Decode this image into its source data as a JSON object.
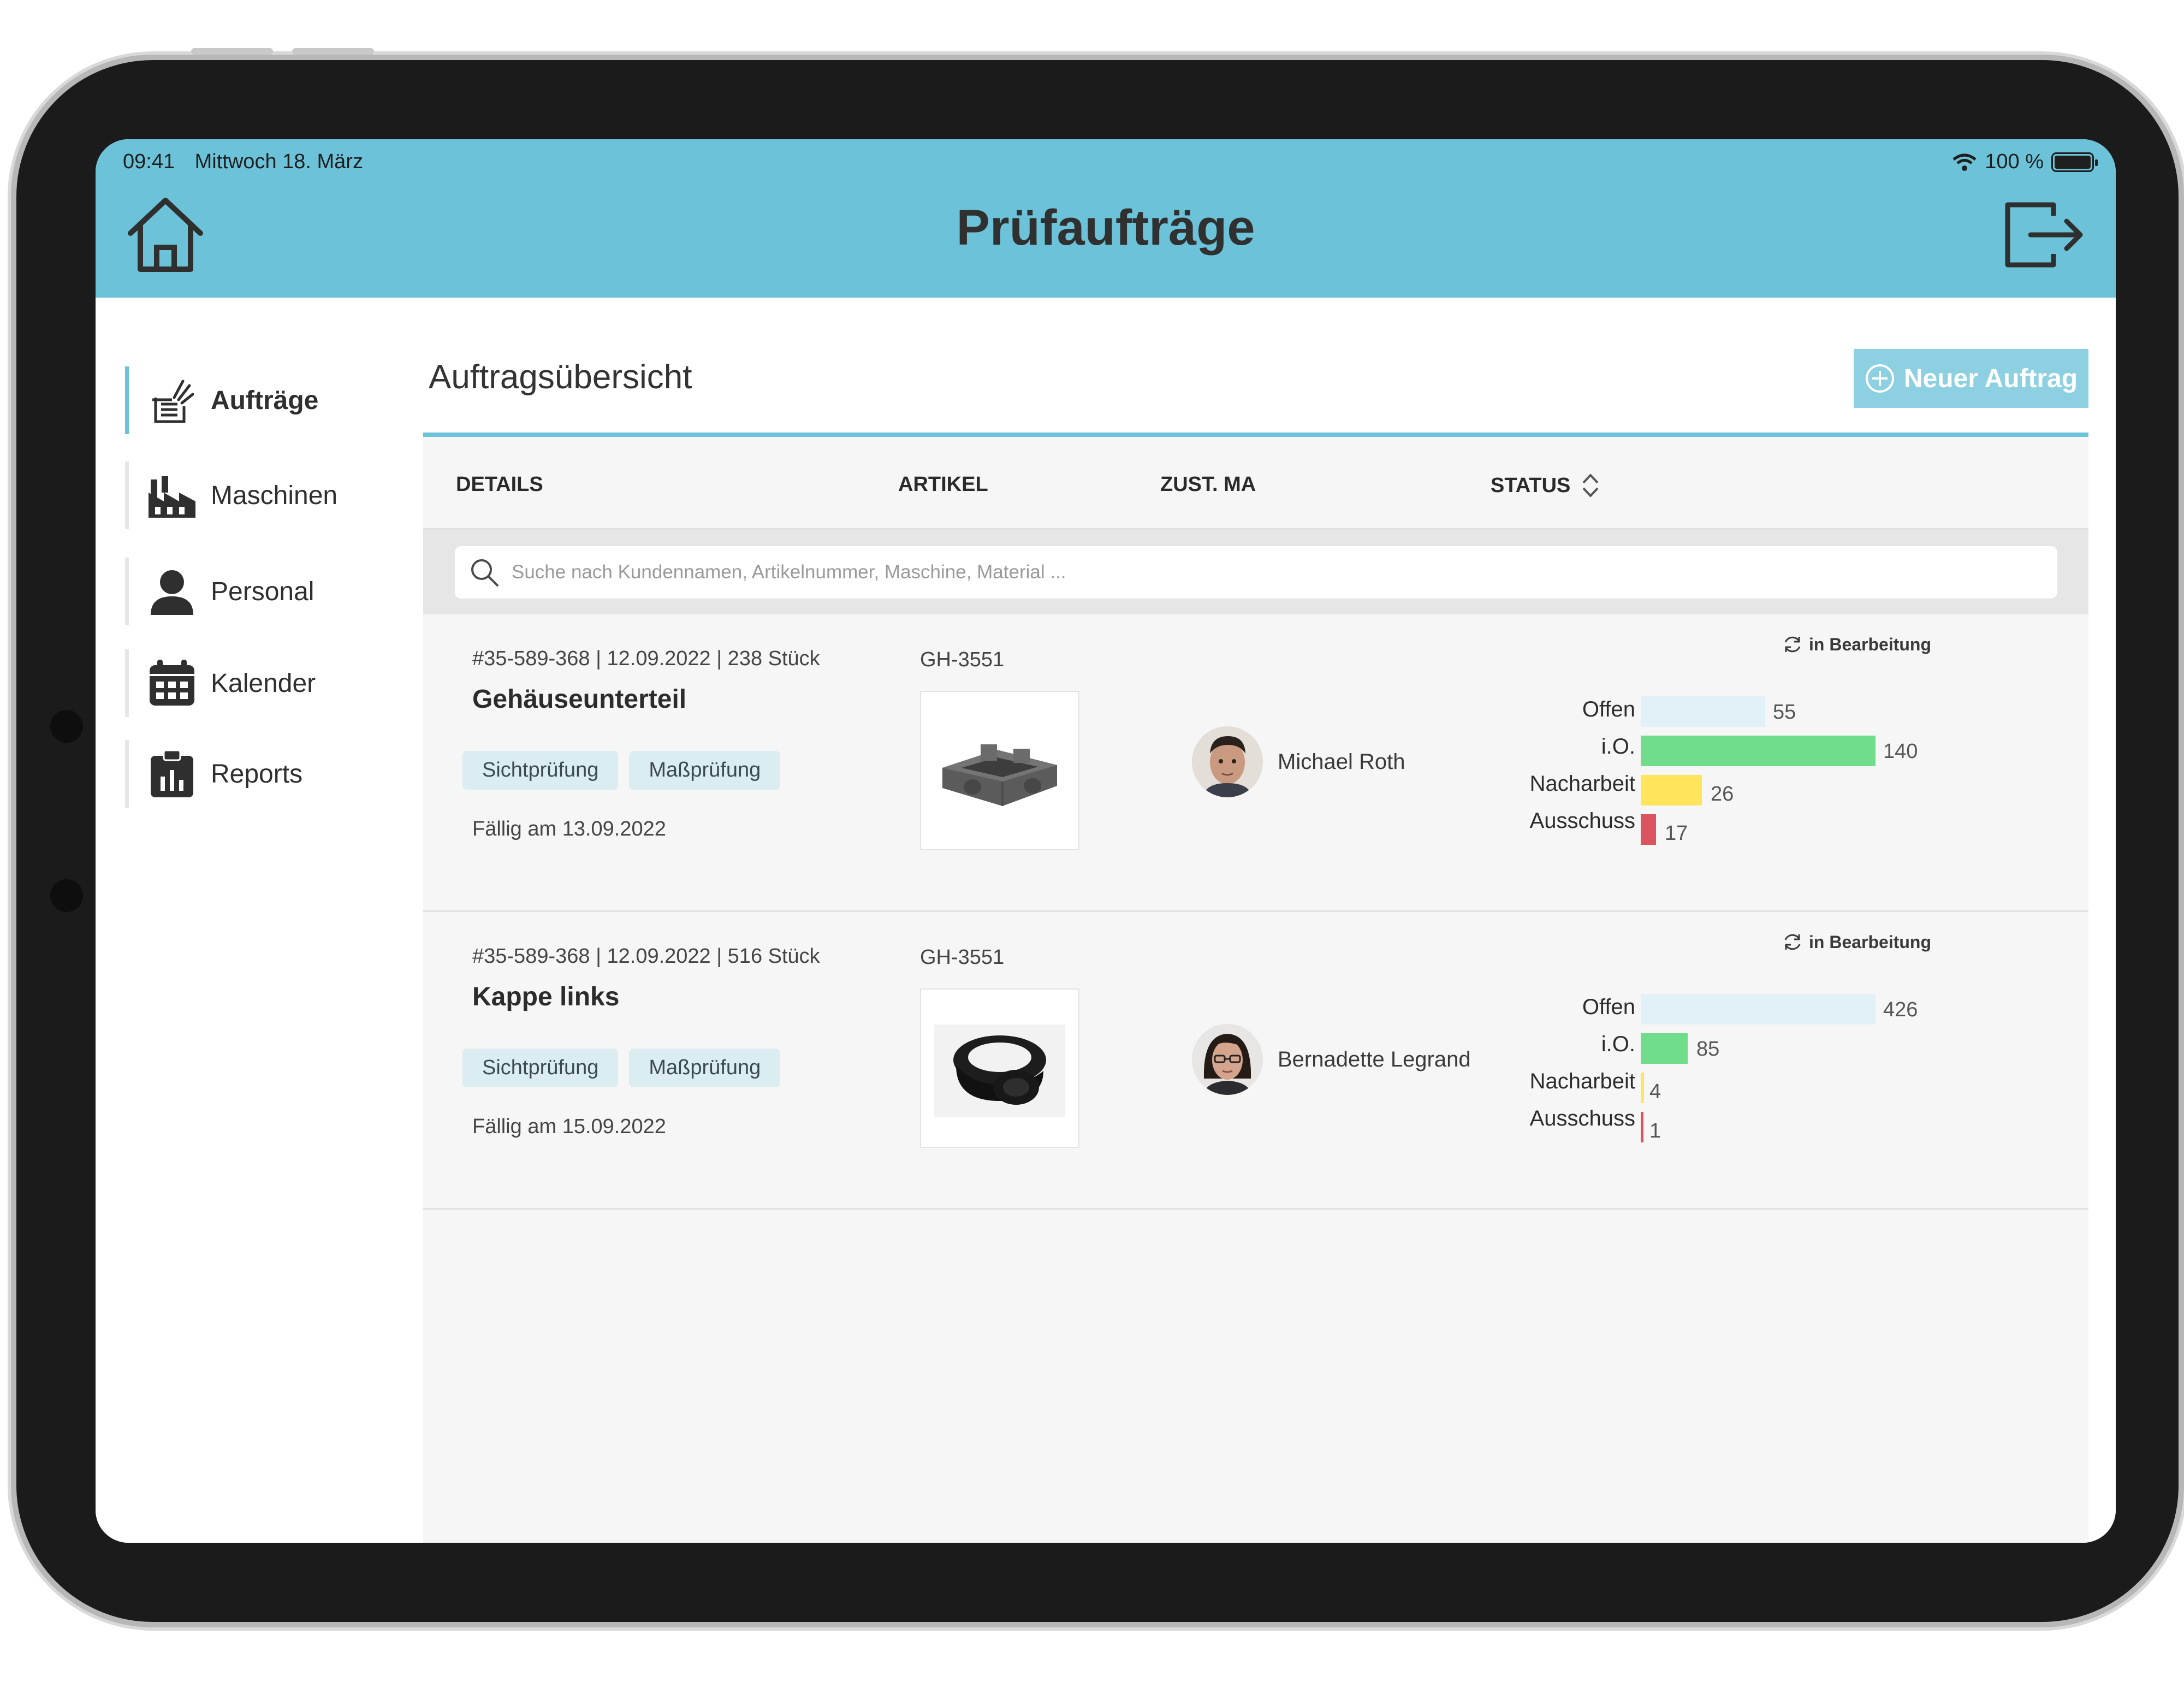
{
  "status_bar": {
    "time": "09:41",
    "date": "Mittwoch 18. März",
    "battery": "100 %"
  },
  "header": {
    "title": "Prüfaufträge"
  },
  "icons": {
    "home": "home-icon",
    "logout": "logout-icon",
    "search": "search-icon",
    "refresh": "refresh-icon",
    "plus": "plus-circle-icon",
    "sort": "sort-icon"
  },
  "sidebar": {
    "items": [
      {
        "label": "Aufträge",
        "icon": "orders-icon",
        "active": true
      },
      {
        "label": "Maschinen",
        "icon": "factory-icon",
        "active": false
      },
      {
        "label": "Personal",
        "icon": "person-icon",
        "active": false
      },
      {
        "label": "Kalender",
        "icon": "calendar-icon",
        "active": false
      },
      {
        "label": "Reports",
        "icon": "clipboard-chart-icon",
        "active": false
      }
    ]
  },
  "main": {
    "heading": "Auftragsübersicht",
    "new_order_label": "Neuer Auftrag",
    "columns": {
      "details": "DETAILS",
      "article": "ARTIKEL",
      "assignee": "ZUST. MA",
      "status": "STATUS"
    },
    "search": {
      "placeholder": "Suche nach Kundennamen, Artikelnummer, Maschine, Material ..."
    },
    "orders": [
      {
        "meta": "#35-589-368 | 12.09.2022 | 238 Stück",
        "title": "Gehäuseunterteil",
        "tags": [
          "Sichtprüfung",
          "Maßprüfung"
        ],
        "due": "Fällig am 13.09.2022",
        "article": "GH-3551",
        "assignee": "Michael Roth",
        "status": "in Bearbeitung",
        "stats": [
          {
            "label": "Offen",
            "value": "55"
          },
          {
            "label": "i.O.",
            "value": "140"
          },
          {
            "label": "Nacharbeit",
            "value": "26"
          },
          {
            "label": "Ausschuss",
            "value": "17"
          }
        ]
      },
      {
        "meta": "#35-589-368 | 12.09.2022 | 516 Stück",
        "title": "Kappe links",
        "tags": [
          "Sichtprüfung",
          "Maßprüfung"
        ],
        "due": "Fällig am 15.09.2022",
        "article": "GH-3551",
        "assignee": "Bernadette Legrand",
        "status": "in Bearbeitung",
        "stats": [
          {
            "label": "Offen",
            "value": "426"
          },
          {
            "label": "i.O.",
            "value": "85"
          },
          {
            "label": "Nacharbeit",
            "value": "4"
          },
          {
            "label": "Ausschuss",
            "value": "1"
          }
        ]
      }
    ]
  },
  "colors": {
    "accent": "#6cc3d9",
    "offen": "#e2f1f7",
    "io": "#6fdd8b",
    "nacharbeit": "#ffe45c",
    "ausschuss": "#d9545f"
  }
}
